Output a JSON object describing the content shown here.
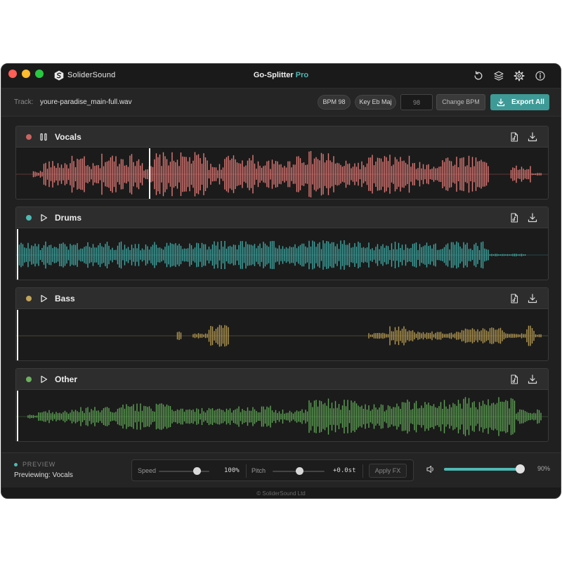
{
  "app": {
    "brand": "SoliderSound",
    "title": "Go-Splitter",
    "title_suffix": "Pro",
    "accent": "#4fb9b4"
  },
  "toolbar_icons": [
    "refresh-icon",
    "layers-icon",
    "gear-icon",
    "info-icon"
  ],
  "track": {
    "label": "Track:",
    "filename": "youre-paradise_main-full.wav",
    "bpm_badge": "BPM 98",
    "key_badge": "Key Eb Maj",
    "bpm_input_value": "98",
    "change_bpm_label": "Change BPM",
    "export_all_label": "Export All"
  },
  "stems": [
    {
      "name": "Vocals",
      "color": "#e07a76",
      "dot_color": "#c96561",
      "state": "playing",
      "playhead": 0.25
    },
    {
      "name": "Drums",
      "color": "#3fa8a3",
      "dot_color": "#4fb9b4",
      "state": "stopped",
      "playhead": 0.0
    },
    {
      "name": "Bass",
      "color": "#b59a52",
      "dot_color": "#c2a45a",
      "state": "stopped",
      "playhead": 0.0
    },
    {
      "name": "Other",
      "color": "#5fa355",
      "dot_color": "#6cb05e",
      "state": "stopped",
      "playhead": 0.0
    }
  ],
  "preview": {
    "label": "PREVIEW",
    "text": "Previewing: Vocals"
  },
  "fx": {
    "speed_label": "Speed",
    "speed_value": "100%",
    "speed_level": 0.5,
    "pitch_label": "Pitch",
    "pitch_value": "+0.0st",
    "pitch_level": 0.5,
    "apply_label": "Apply FX"
  },
  "volume": {
    "value": "90%",
    "level": 0.9
  },
  "footer": "© SoliderSound Ltd"
}
